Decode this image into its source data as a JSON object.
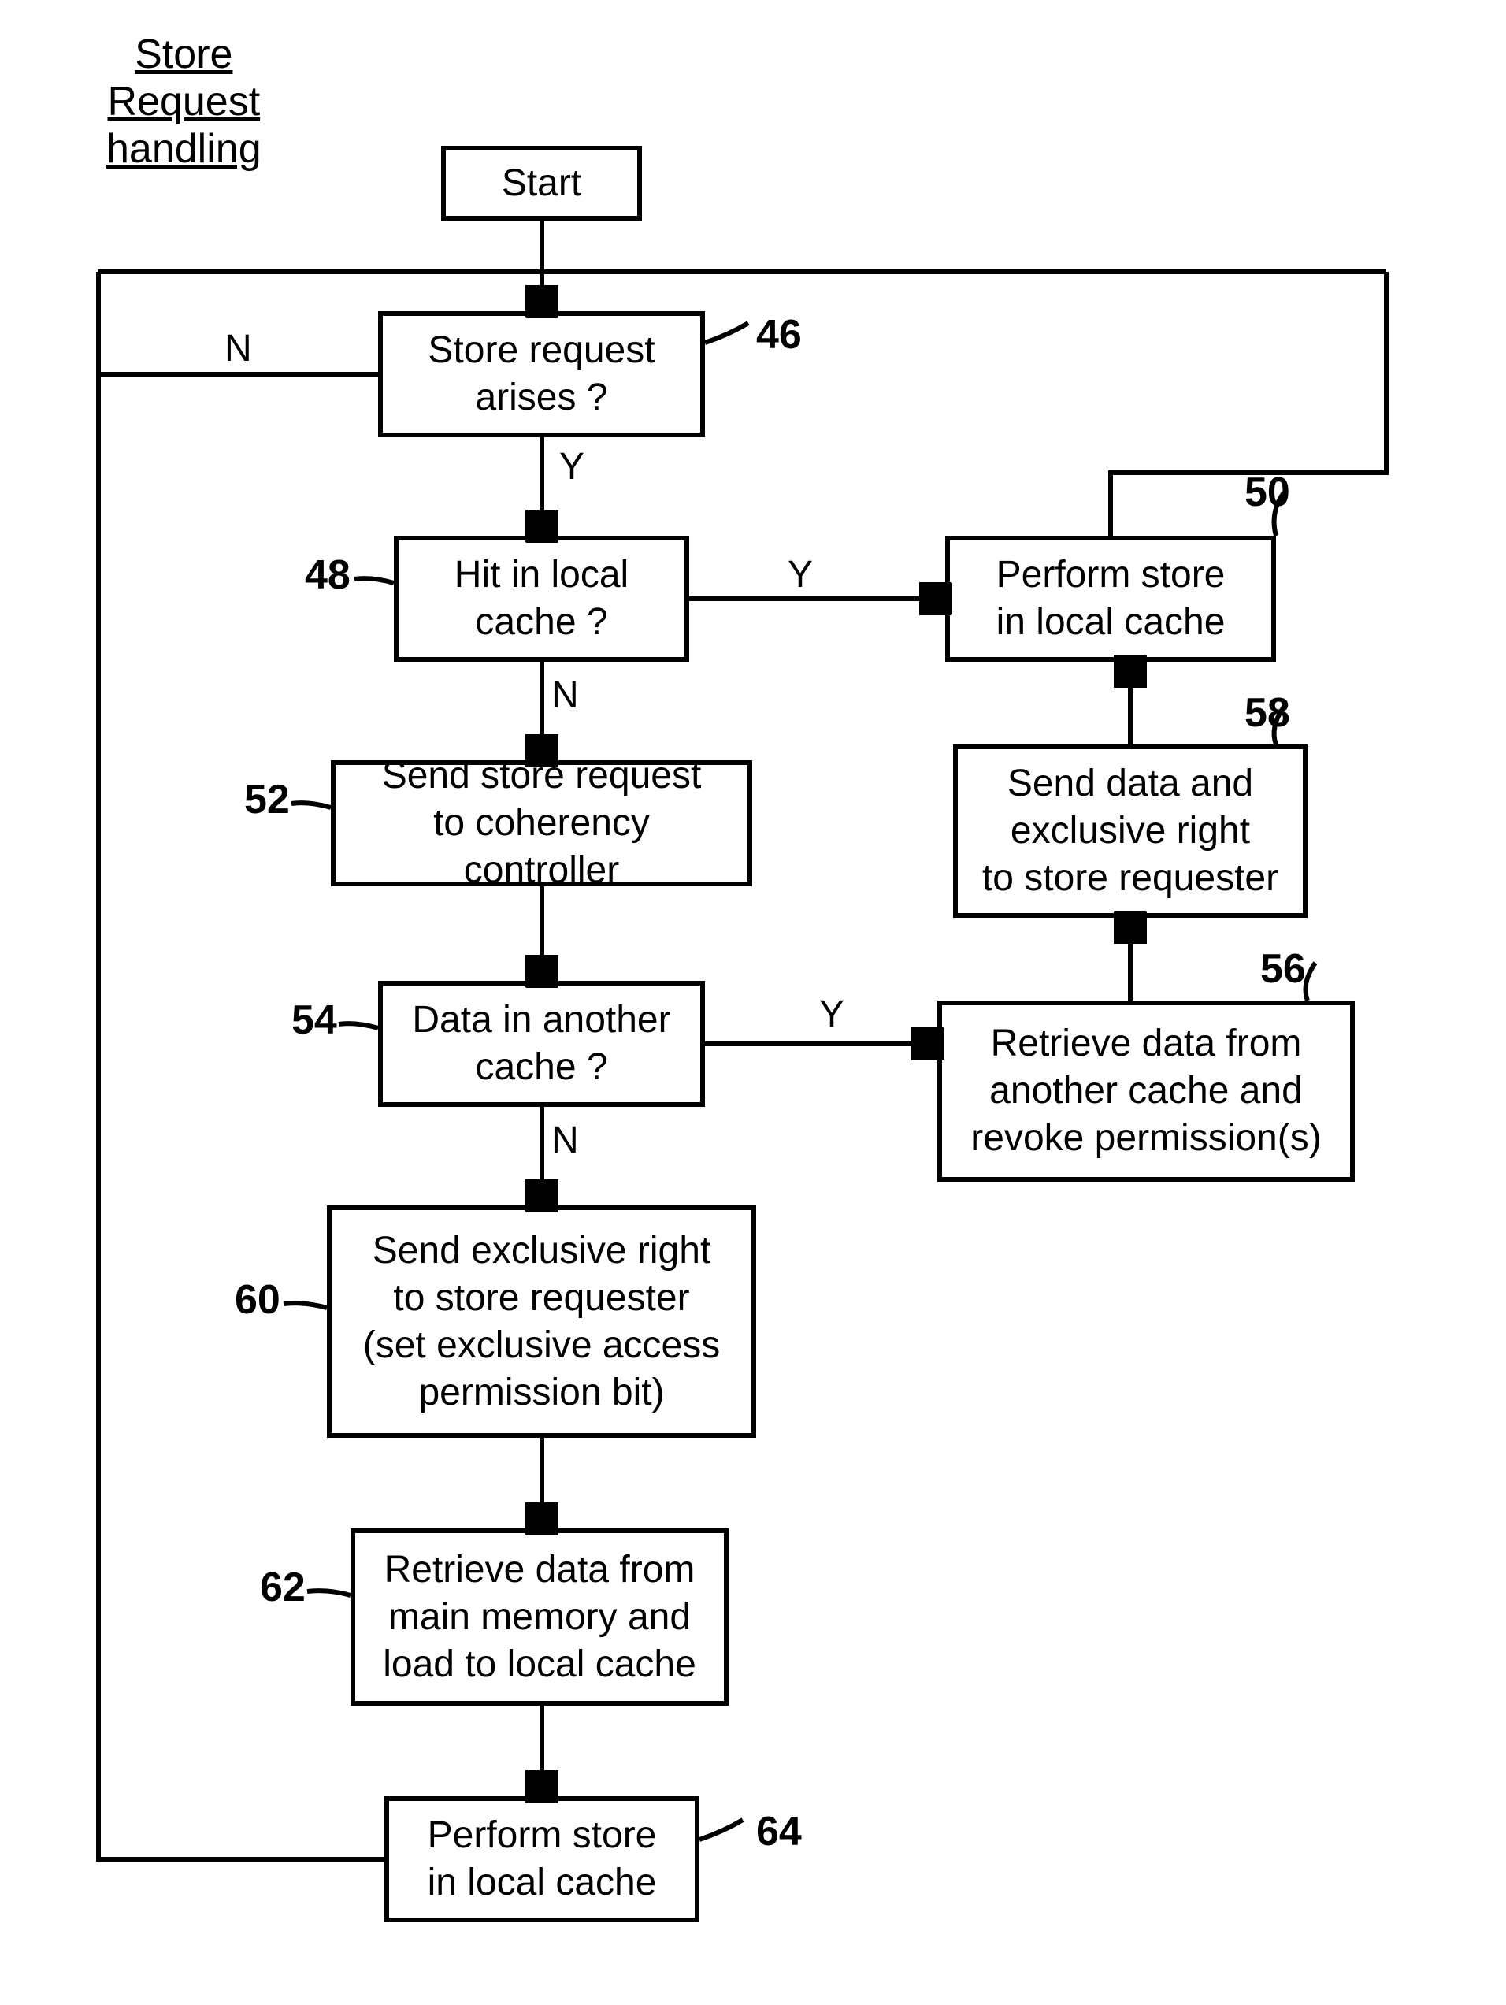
{
  "title_line1": "Store",
  "title_line2": "Request",
  "title_line3": "handling",
  "nodes": {
    "start": "Start",
    "n46": "Store request\narises ?",
    "n48": "Hit in local\ncache ?",
    "n50": "Perform store\nin local cache",
    "n52": "Send store request\nto coherency controller",
    "n54": "Data in another\ncache ?",
    "n56": "Retrieve data from\nanother cache and\nrevoke permission(s)",
    "n58": "Send data and\nexclusive right\nto store requester",
    "n60": "Send exclusive right\nto store requester\n(set exclusive access\npermission bit)",
    "n62": "Retrieve data from\nmain memory and\nload to local cache",
    "n64": "Perform store\nin local cache"
  },
  "refs": {
    "r46": "46",
    "r48": "48",
    "r50": "50",
    "r52": "52",
    "r54": "54",
    "r56": "56",
    "r58": "58",
    "r60": "60",
    "r62": "62",
    "r64": "64"
  },
  "labels": {
    "Y": "Y",
    "N": "N"
  }
}
